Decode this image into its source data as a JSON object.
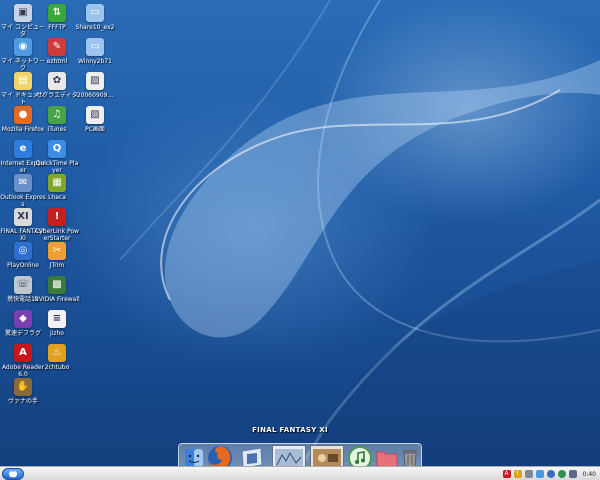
{
  "desktop": {
    "icons": [
      {
        "label": "マイ コンピュータ",
        "icon": "computer-icon",
        "color": "#c8d4e6"
      },
      {
        "label": "マイ ネットワーク",
        "icon": "network-icon",
        "color": "#4f9ae0"
      },
      {
        "label": "マイ ドキュメント",
        "icon": "documents-folder-icon",
        "color": "#f1d36b"
      },
      {
        "label": "Mozilla Firefox",
        "icon": "firefox-icon",
        "color": "#e56a1d"
      },
      {
        "label": "Internet Explorer",
        "icon": "ie-icon",
        "color": "#2b7de0"
      },
      {
        "label": "Outlook Express",
        "icon": "outlook-icon",
        "color": "#6a8fc9"
      },
      {
        "label": "FINAL FANTASY XI",
        "icon": "ffxi-icon",
        "color": "#d9d9d9"
      },
      {
        "label": "PlayOnline",
        "icon": "playonline-icon",
        "color": "#2f6fd0"
      },
      {
        "label": "携快電話12",
        "icon": "phone-icon",
        "color": "#bfc7cf"
      },
      {
        "label": "驚速デフラグ",
        "icon": "defrag-icon",
        "color": "#7a3fb0"
      },
      {
        "label": "Adobe Reader 6.0",
        "icon": "adobe-reader-icon",
        "color": "#c8161d"
      },
      {
        "label": "ヴァナの手",
        "icon": "vana-icon",
        "color": "#8a6a3a"
      },
      {
        "label": "FFFTP",
        "icon": "ffftp-icon",
        "color": "#39a839"
      },
      {
        "label": "ezhtml",
        "icon": "ezhtml-icon",
        "color": "#d03a3a"
      },
      {
        "label": "サクラエディタ",
        "icon": "sakura-editor-icon",
        "color": "#e8e8e8"
      },
      {
        "label": "iTunes",
        "icon": "itunes-icon",
        "color": "#47a447"
      },
      {
        "label": "QuickTime Player",
        "icon": "quicktime-icon",
        "color": "#3a8ee6"
      },
      {
        "label": "Lhaca",
        "icon": "lhaca-icon",
        "color": "#7fa82a"
      },
      {
        "label": "CyberLink PowerStarter",
        "icon": "cyberlink-icon",
        "color": "#c81e1e"
      },
      {
        "label": "JTrim",
        "icon": "jtrim-icon",
        "color": "#f0a030"
      },
      {
        "label": "NVIDIA Firewall",
        "icon": "nvidia-firewall-icon",
        "color": "#3a7a3a"
      },
      {
        "label": "jizho",
        "icon": "text-file-icon",
        "color": "#f2f2f2"
      },
      {
        "label": "2chtubo",
        "icon": "2chtubo-icon",
        "color": "#e0a020"
      },
      {
        "label": "Share10_ex2",
        "icon": "folder-icon",
        "color": "#9cc4ee"
      },
      {
        "label": "Winny2b71",
        "icon": "folder-icon",
        "color": "#9cc4ee"
      },
      {
        "label": "20060909...",
        "icon": "image-file-icon",
        "color": "#eeeeee"
      },
      {
        "label": "PC画面",
        "icon": "image-file-icon",
        "color": "#eeeeee"
      }
    ]
  },
  "dock": {
    "tooltip": "FINAL FANTASY XI",
    "items": [
      {
        "name": "finder-icon",
        "color": "#3a7fd5"
      },
      {
        "name": "firefox-icon",
        "color": "#e56a1d"
      },
      {
        "name": "mail-icon",
        "color": "#8fa8c8"
      },
      {
        "name": "ffxi-window-thumbnail",
        "color": "#e8eef4"
      },
      {
        "name": "playonline-window-thumbnail",
        "color": "#c8a070"
      },
      {
        "name": "itunes-icon",
        "color": "#5bb85b"
      },
      {
        "name": "folder-icon",
        "color": "#e8707a"
      },
      {
        "name": "trash-icon",
        "color": "#7a7a7a"
      }
    ]
  },
  "taskbar": {
    "clock": "0:40",
    "start_color": "#1f66d0"
  }
}
